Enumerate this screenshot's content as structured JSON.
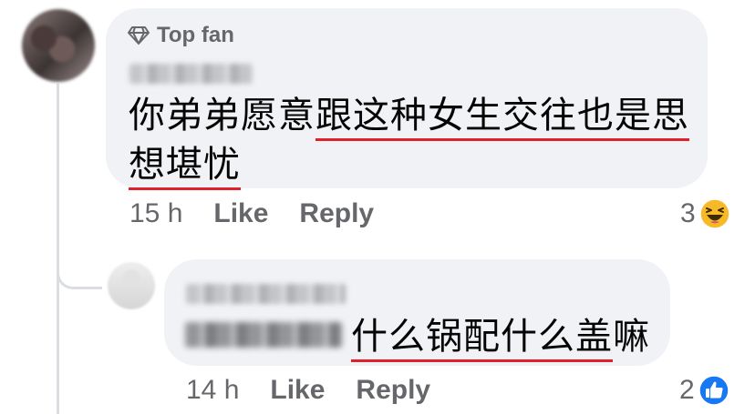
{
  "main_comment": {
    "badge_label": "Top fan",
    "badge_icon": "diamond-icon",
    "author": "Colin Lee",
    "text_plain": "你弟弟愿意",
    "text_underlined_1": "跟这种女生交往也是思",
    "text_underlined_2": "想堪忧",
    "time": "15 h",
    "like_label": "Like",
    "reply_label": "Reply",
    "reaction_count": "3",
    "reaction_icon": "haha-icon"
  },
  "reply_comment": {
    "author": "Lee Shi Min",
    "tag": "Colin Lee",
    "text_underlined": "什么锅配什么盖",
    "text_plain": "嘛",
    "time": "14 h",
    "like_label": "Like",
    "reply_label": "Reply",
    "reaction_count": "2",
    "reaction_icon": "like-icon"
  },
  "colors": {
    "bubble": "#f0f2f5",
    "meta": "#65676b",
    "underline": "#e0202a",
    "like_blue": "#1877f2",
    "haha_yellow": "#f7b928"
  }
}
